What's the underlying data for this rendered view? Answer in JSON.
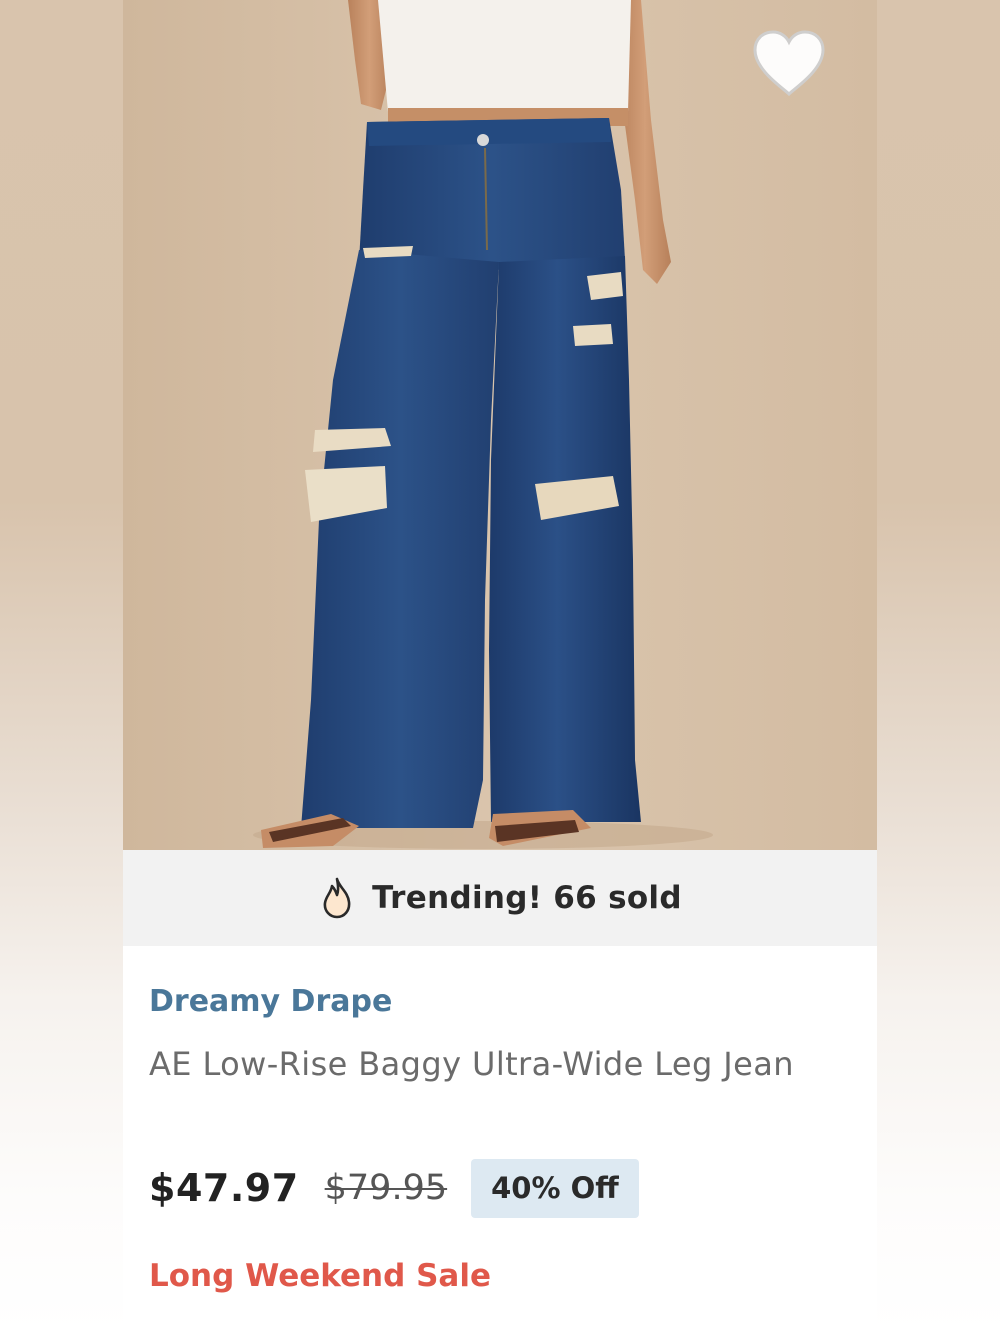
{
  "product": {
    "image_alt": "low-rise baggy ultra-wide leg ripped jeans",
    "favorite_icon": "heart-outline-icon",
    "trending": {
      "icon": "flame-icon",
      "text": "Trending! 66 sold"
    },
    "brand": "Dreamy Drape",
    "name": "AE Low-Rise Baggy Ultra-Wide Leg Jean",
    "sale_price": "$47.97",
    "original_price": "$79.95",
    "discount": "40% Off",
    "promo": "Long Weekend Sale"
  },
  "colors": {
    "brand_blue": "#4a7799",
    "promo_red": "#e0584a",
    "badge_bg": "#dde9f2",
    "trending_bg": "#f2f2f2"
  }
}
